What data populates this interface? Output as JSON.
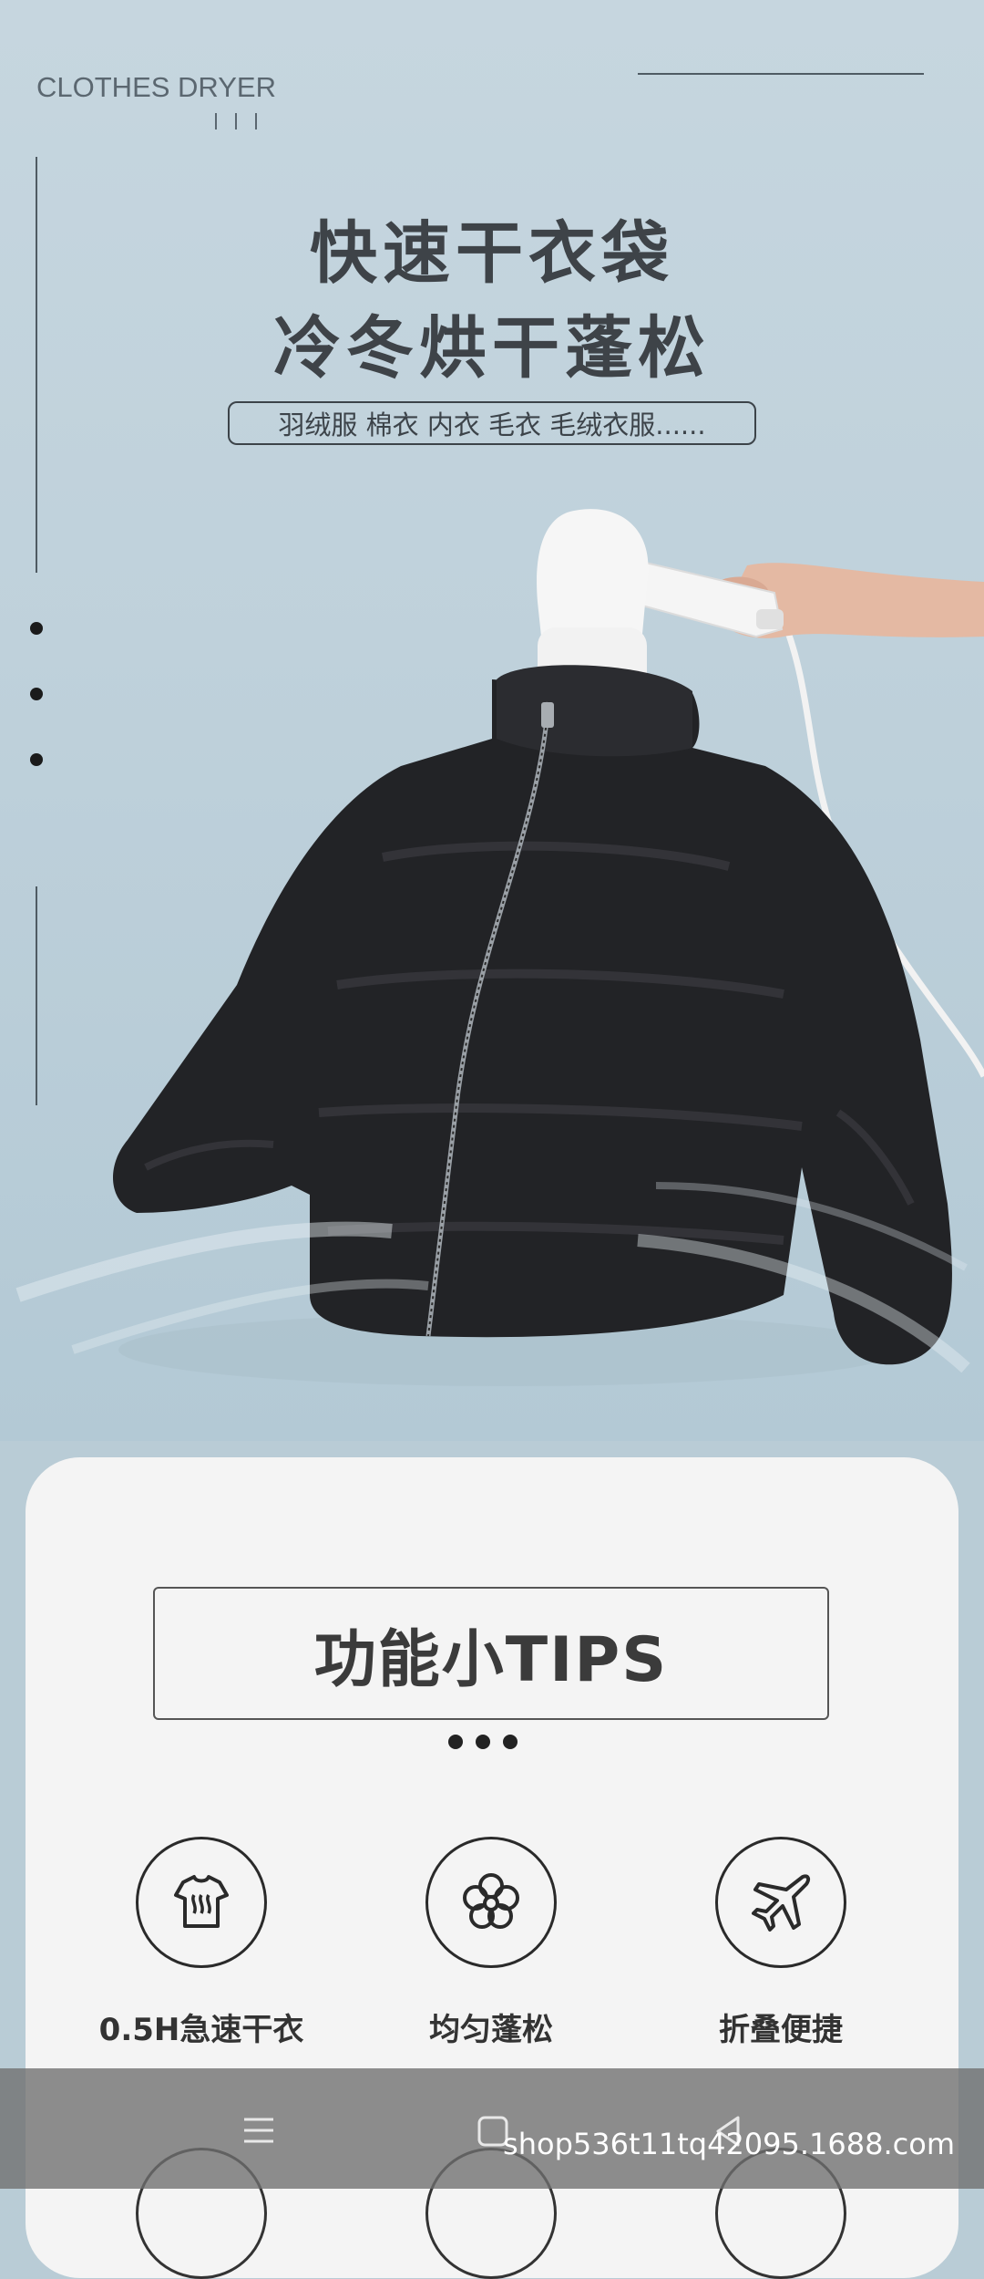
{
  "hero": {
    "brand": "CLOTHES DRYER",
    "title_line1": "快速干衣袋",
    "title_line2": "冷冬烘干蓬松",
    "tags": "羽绒服 棉衣 内衣 毛衣 毛绒衣服......"
  },
  "tips": {
    "title": "功能小TIPS",
    "features": [
      {
        "label": "0.5H急速干衣",
        "icon": "steam-shirt-icon"
      },
      {
        "label": "均匀蓬松",
        "icon": "flower-icon"
      },
      {
        "label": "折叠便捷",
        "icon": "airplane-icon"
      }
    ]
  },
  "nav": {
    "menu_icon": "menu-icon",
    "home_icon": "home-icon",
    "back_icon": "back-icon"
  },
  "watermark": "shop536t11tq42095.1688.com",
  "colors": {
    "background": "#bfd1db",
    "card": "#f4f4f4",
    "jacket": "#1e1f21",
    "text": "#3e4348"
  }
}
